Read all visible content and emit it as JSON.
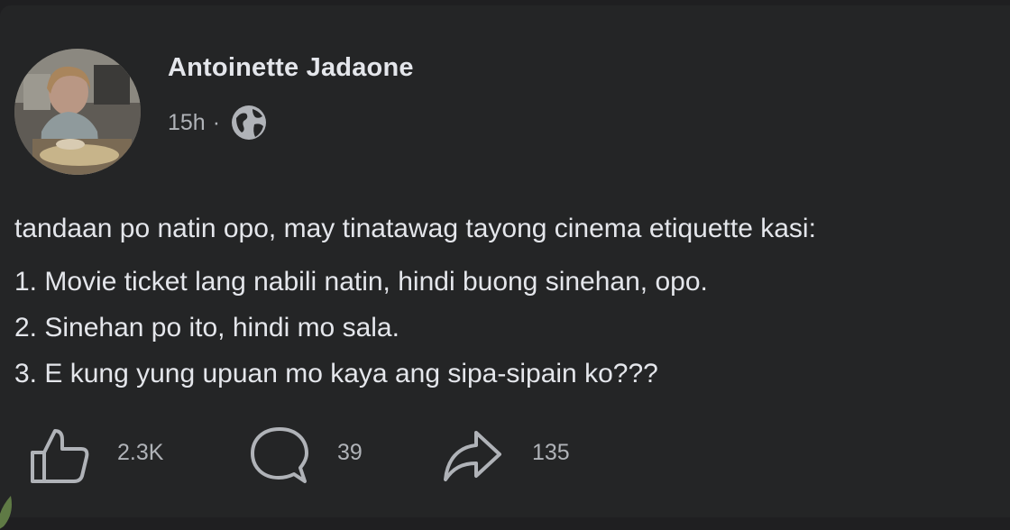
{
  "post": {
    "author": "Antoinette Jadaone",
    "time": "15h",
    "separator": "·",
    "privacy_icon": "globe-icon",
    "intro": "tandaan po natin opo, may tinatawag tayong cinema etiquette kasi:",
    "list": [
      "1. Movie ticket lang nabili natin, hindi buong sinehan, opo.",
      "2. Sinehan po ito, hindi mo sala.",
      "3. E kung yung upuan mo kaya ang sipa-sipain ko???"
    ]
  },
  "actions": {
    "like": {
      "icon": "thumbs-up-icon",
      "count": "2.3K"
    },
    "comment": {
      "icon": "comment-bubble-icon",
      "count": "39"
    },
    "share": {
      "icon": "share-arrow-icon",
      "count": "135"
    }
  },
  "colors": {
    "background": "#242526",
    "text_primary": "#e4e6eb",
    "text_secondary": "#b0b3b8"
  }
}
